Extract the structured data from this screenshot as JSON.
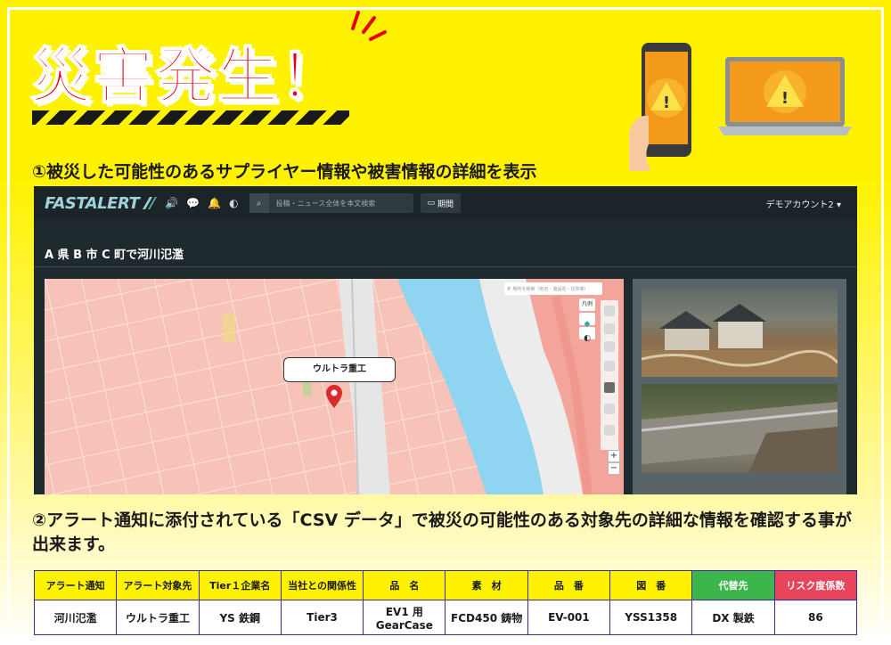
{
  "banner": {
    "headline": "災害発生！",
    "step1": "①被災した可能性のあるサプライヤー情報や被害情報の詳細を表示",
    "step2": "②アラート通知に添付されている「CSV データ」で被災の可能性のある対象先の詳細な情報を確認する事が出来ます。"
  },
  "app": {
    "logo": "FASTALERT",
    "search_placeholder": "投稿・ニュース全体を本文検索",
    "period_label": "期間",
    "account": "デモアカウント2 ▾",
    "event_title": "A 県 B 市 C 町で河川氾濫",
    "map": {
      "place_search_placeholder": "場所を検索（地名・施設名・住所等）",
      "pin_label": "ウルトラ重工",
      "legend_button": "凡例",
      "zoom_in": "+",
      "zoom_out": "−"
    }
  },
  "colors": {
    "headline": "#e60012",
    "brand": "#9fd3d6",
    "alt_header": "#3cb64a",
    "risk_header": "#e8455c",
    "table_border": "#3a2d8c"
  },
  "table": {
    "headers": [
      "アラート通知",
      "アラート対象先",
      "Tier１企業名",
      "当社との関係性",
      "品　名",
      "素　材",
      "品　番",
      "図　番",
      "代替先",
      "リスク度係数"
    ],
    "row": [
      "河川氾濫",
      "ウルトラ重工",
      "YS 鉄鋼",
      "Tier3",
      "EV1 用 GearCase",
      "FCD450 鋳物",
      "EV-001",
      "YSS1358",
      "DX 製鉄",
      "86"
    ]
  }
}
